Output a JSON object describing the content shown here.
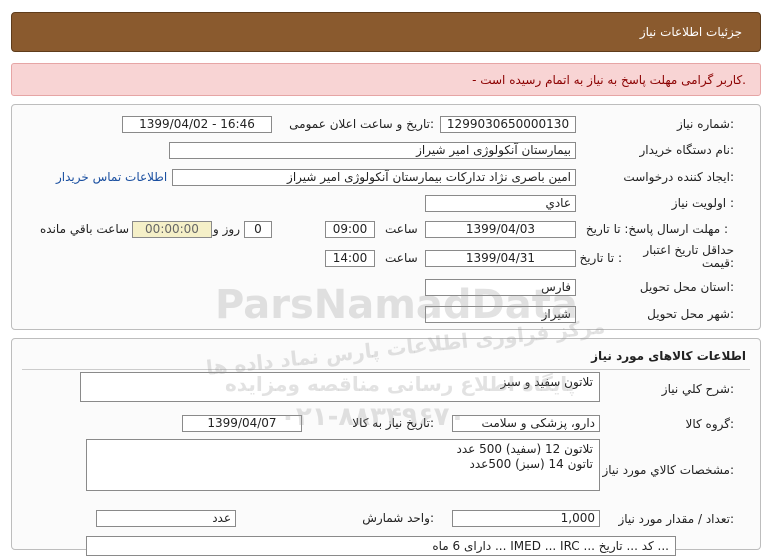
{
  "header": {
    "title": "جزئيات اطلاعات نياز"
  },
  "alert": {
    "message": "- کاربر گرامی مهلت پاسخ به نیاز به اتمام رسیده است."
  },
  "details": {
    "need_number_label": "شماره نياز:",
    "need_number": "1299030650000130",
    "announce_label": "تاريخ و ساعت اعلان عمومی:",
    "announce_value": "1399/04/02 - 16:46",
    "buyer_label": "نام دستگاه خريدار:",
    "buyer_value": "بیمارستان آنکولوژی امیر شیراز",
    "creator_label": "ايجاد کننده درخواست:",
    "creator_value": "امین باصری نژاد تدارکات بیمارستان آنکولوژی امیر شیراز",
    "contact_link": "اطلاعات تماس خريدار",
    "priority_label": "اولويت نياز :",
    "priority_value": "عادي",
    "deadline_label": "مهلت ارسال پاسخ:",
    "to_date_label": "تا تاريخ :",
    "deadline_date": "1399/04/03",
    "time_label": "ساعت",
    "deadline_time": "09:00",
    "days_value": "0",
    "days_label": "روز و",
    "remaining_value": "00:00:00",
    "remaining_label": "ساعت باقي مانده",
    "validity_label": "حداقل تاريخ اعتبار قيمت:",
    "validity_to_label": "تا تاريخ :",
    "validity_date": "1399/04/31",
    "validity_time_label": "ساعت",
    "validity_time": "14:00",
    "province_label": "استان محل تحويل:",
    "province_value": "فارس",
    "city_label": "شهر محل تحويل:",
    "city_value": "شيراز"
  },
  "goods": {
    "title": "اطلاعات کالاهای مورد نیاز",
    "desc_label": "شرح کلي نياز:",
    "desc_value": "تلاتون سفید و سبز",
    "group_label": "گروه کالا:",
    "group_value": "دارو، پزشکی و سلامت",
    "need_date_label": "تاريخ نياز به کالا:",
    "need_date": "1399/04/07",
    "spec_label": "مشخصات کالاي مورد نياز:",
    "spec_line1": "تلاتون 12 (سفید) 500 عدد",
    "spec_line2": "تاتون 14 (سبز) 500عدد",
    "qty_label": "تعداد / مقدار مورد نياز:",
    "qty_value": "1,000",
    "unit_label": "واحد شمارش:",
    "unit_value": "عدد",
    "bottom_text": "دارای 6 ماه ... IMED ... IRC ... کد ... تاریخ ..."
  },
  "watermark": {
    "line1": "ParsNamadData",
    "line2": "مرکز فراوری اطلاعات پارس نماد داده ها",
    "line3": "پایگاه اطلاع رسانی مناقصه ومزایده",
    "line4": "۰۲۱-۸۸۳۴۹۶۷۰"
  }
}
